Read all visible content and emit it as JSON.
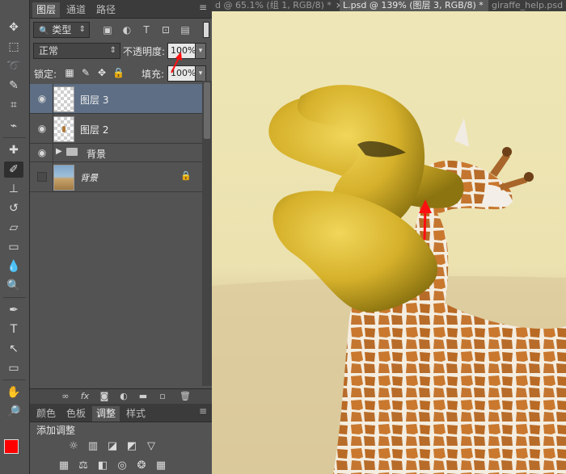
{
  "document_tabs": [
    {
      "label": "d @ 65.1% (组 1, RGB/8) *",
      "active": false
    },
    {
      "label": "L.psd @ 139% (图层 3, RGB/8) *",
      "active": true
    },
    {
      "label": "giraffe_help.psd",
      "active": false
    }
  ],
  "layers_panel": {
    "tabs": [
      "图层",
      "通道",
      "路径"
    ],
    "filter_kind": "类型",
    "blend_mode": "正常",
    "opacity_label": "不透明度:",
    "opacity_value": "100%",
    "lock_label": "锁定:",
    "fill_label": "填充:",
    "fill_value": "100%",
    "layers": [
      {
        "name": "图层 3",
        "selected": true,
        "visible": true
      },
      {
        "name": "图层 2",
        "selected": false,
        "visible": true
      },
      {
        "name": "背景",
        "selected": false,
        "visible": true,
        "type": "group"
      },
      {
        "name": "背景",
        "selected": false,
        "visible": false,
        "locked": true
      }
    ]
  },
  "adjustments_panel": {
    "tabs": [
      "颜色",
      "色板",
      "调整",
      "样式"
    ],
    "active_tab": "调整",
    "heading": "添加调整"
  },
  "colors": {
    "foreground": "#ff0000",
    "background": "#000000",
    "selected_layer": "#5d6e85"
  },
  "annotations": [
    "red-arrow-opacity",
    "red-arrow-neck"
  ]
}
